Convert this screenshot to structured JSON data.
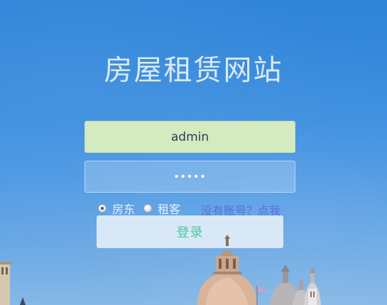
{
  "title": "房屋租赁网站",
  "form": {
    "username_value": "admin",
    "password_masked": "•••••",
    "roles": [
      {
        "label": "房东",
        "checked": true
      },
      {
        "label": "租客",
        "checked": false
      }
    ],
    "signup_link": "没有账号？点我",
    "login_label": "登录"
  },
  "colors": {
    "username_bg": "#d4eabf",
    "button_text": "#4fc79a",
    "link": "#5b6fd6"
  }
}
